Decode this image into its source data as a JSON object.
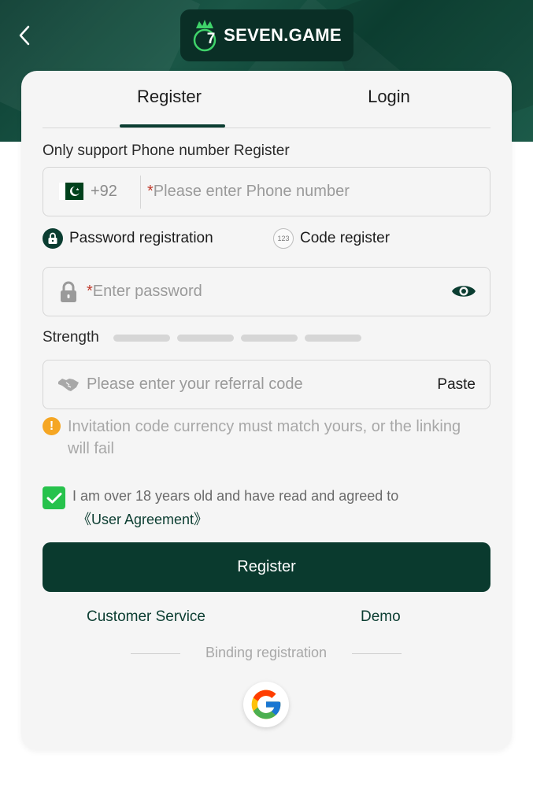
{
  "header": {
    "back_icon": "chevron-left-icon",
    "logo_text": "SEVEN.GAME",
    "logo_badge": "7"
  },
  "tabs": [
    {
      "label": "Register",
      "active": true
    },
    {
      "label": "Login",
      "active": false
    }
  ],
  "form": {
    "support_text": "Only support Phone number Register",
    "phone": {
      "country_code": "+92",
      "required_mark": "*",
      "placeholder": "Please enter Phone number"
    },
    "registration_options": {
      "password_label": "Password registration",
      "code_label": "Code register",
      "code_badge": "123"
    },
    "password": {
      "required_mark": "*",
      "placeholder": "Enter password"
    },
    "strength_label": "Strength",
    "referral": {
      "placeholder": "Please enter your referral code",
      "paste_label": "Paste"
    },
    "warning_text": "Invitation code currency must match yours, or the linking will fail",
    "agreement": {
      "checked": true,
      "text": "I am over 18 years old and have read and agreed to",
      "link": "《User Agreement》"
    },
    "register_button": "Register"
  },
  "footer": {
    "customer_service": "Customer Service",
    "demo": "Demo",
    "binding_text": "Binding registration"
  },
  "colors": {
    "primary": "#0a3a2e",
    "checkbox": "#27c24c",
    "warning": "#f5a623"
  }
}
